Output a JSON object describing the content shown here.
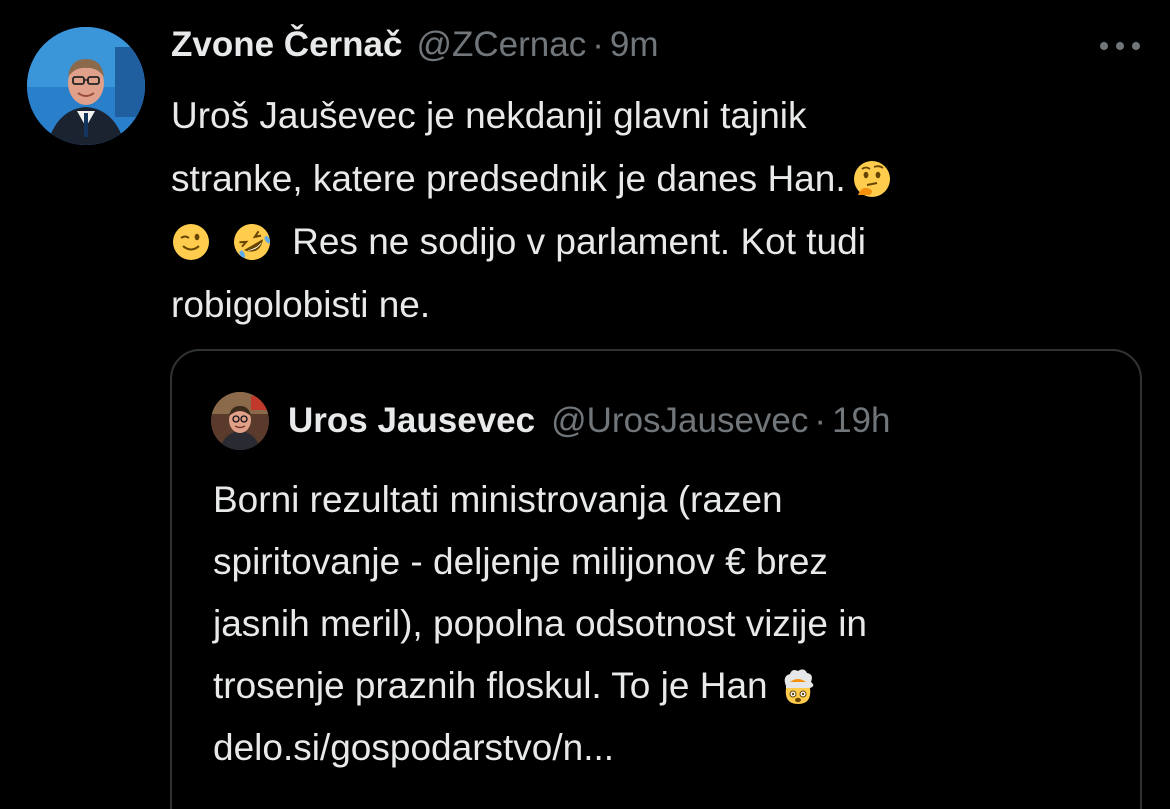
{
  "tweet": {
    "author_name": "Zvone Černač",
    "handle": "@ZCernac",
    "separator": "·",
    "time": "9m",
    "text_lines": [
      "Uroš Jauševec je nekdanji glavni tajnik",
      "stranke, katere predsednik je danes Han.",
      "Res ne sodijo v parlament. Kot tudi",
      "robigolobisti ne."
    ],
    "emojis": [
      "thinking-face",
      "winking-face",
      "rolling-on-floor-laughing"
    ]
  },
  "quote": {
    "author_name": "Uros Jausevec",
    "handle": "@UrosJausevec",
    "separator": "·",
    "time": "19h",
    "text_lines": [
      "Borni rezultati ministrovanja (razen",
      "spiritovanje - deljenje milijonov € brez",
      "jasnih meril), popolna odsotnost vizije in",
      "trosenje praznih floskul. To je Han",
      "delo.si/gospodarstvo/n..."
    ],
    "emojis": [
      "exploding-head"
    ]
  },
  "icons": {
    "more": "more-options-icon"
  },
  "colors": {
    "background": "#000000",
    "text": "#e7e9ea",
    "muted": "#71767b",
    "border": "#2f3336"
  }
}
